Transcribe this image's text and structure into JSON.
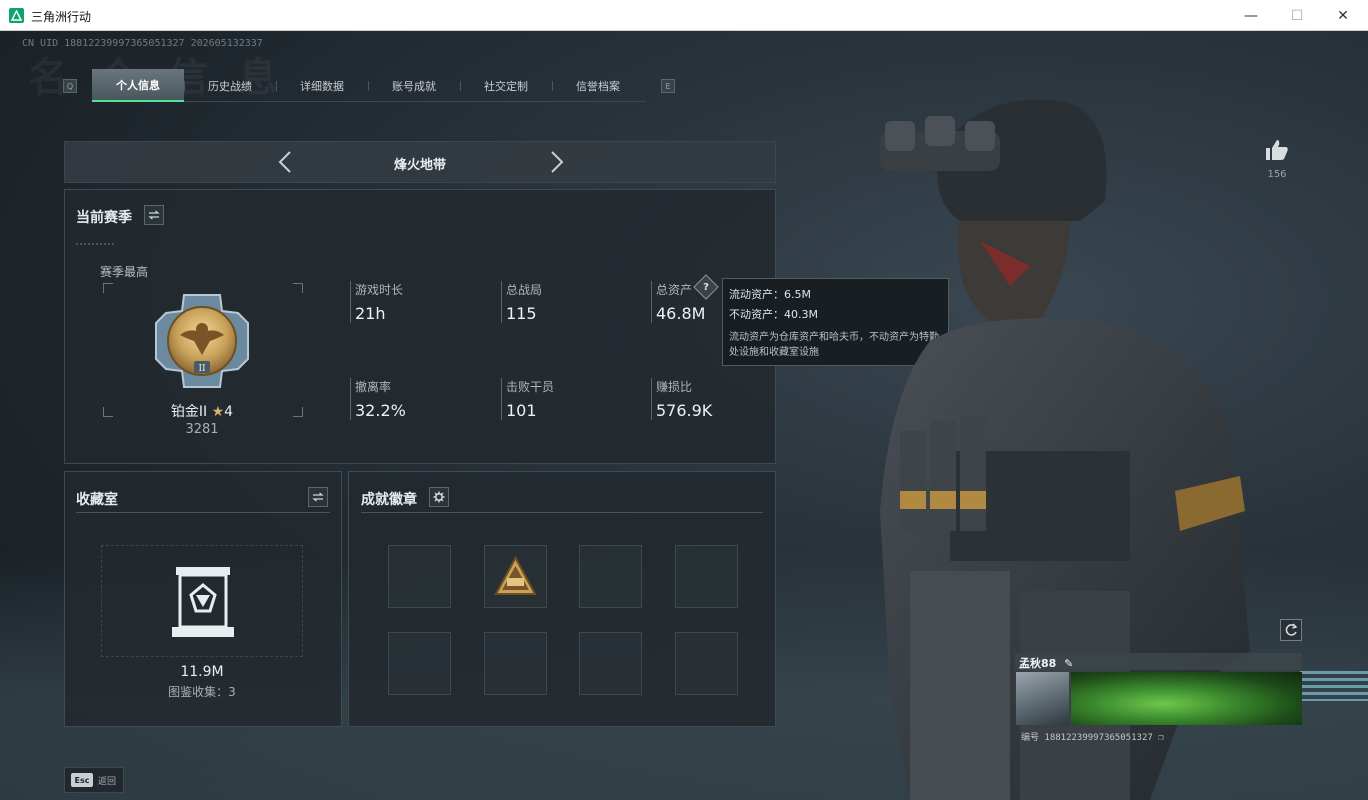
{
  "window": {
    "title": "三角洲行动",
    "minimize_glyph": "—",
    "maximize_glyph": "☐",
    "close_glyph": "✕"
  },
  "header": {
    "uid_line": "CN UID 18812239997365051327 202605132337",
    "bg_title": "名 个 信 息",
    "left_key": "Q",
    "right_key": "E"
  },
  "tabs": [
    {
      "label": "个人信息",
      "active": true
    },
    {
      "label": "历史战绩",
      "active": false
    },
    {
      "label": "详细数据",
      "active": false
    },
    {
      "label": "账号成就",
      "active": false
    },
    {
      "label": "社交定制",
      "active": false
    },
    {
      "label": "信誉档案",
      "active": false
    }
  ],
  "mode": {
    "label": "烽火地带"
  },
  "season": {
    "title": "当前赛季",
    "peak_label": "赛季最高",
    "rank_name": "铂金II",
    "rank_stars": "4",
    "rank_score": "3281",
    "stats": [
      {
        "label": "游戏时长",
        "value": "21h"
      },
      {
        "label": "总战局",
        "value": "115"
      },
      {
        "label": "总资产",
        "value": "46.8M"
      },
      {
        "label": "撤离率",
        "value": "32.2%"
      },
      {
        "label": "击败干员",
        "value": "101"
      },
      {
        "label": "赚损比",
        "value": "576.9K"
      }
    ]
  },
  "tooltip": {
    "liquid": "流动资产：6.5M",
    "fixed": "不动资产：40.3M",
    "note": "流动资产为仓库资产和哈夫币，不动资产为特勤处设施和收藏室设施"
  },
  "collection": {
    "title": "收藏室",
    "value": "11.9M",
    "count": "图鉴收集：3"
  },
  "badges": {
    "title": "成就徽章",
    "slots": 8,
    "filled_index": 1
  },
  "profile": {
    "likes": "156",
    "name": "孟秋88",
    "id_line": "编号 18812239997365051327"
  },
  "footer": {
    "esc_key": "Esc",
    "esc_label": "返回"
  },
  "colors": {
    "accent": "#4ee29a",
    "panel": "#22292f",
    "gold": "#c9a25a"
  }
}
